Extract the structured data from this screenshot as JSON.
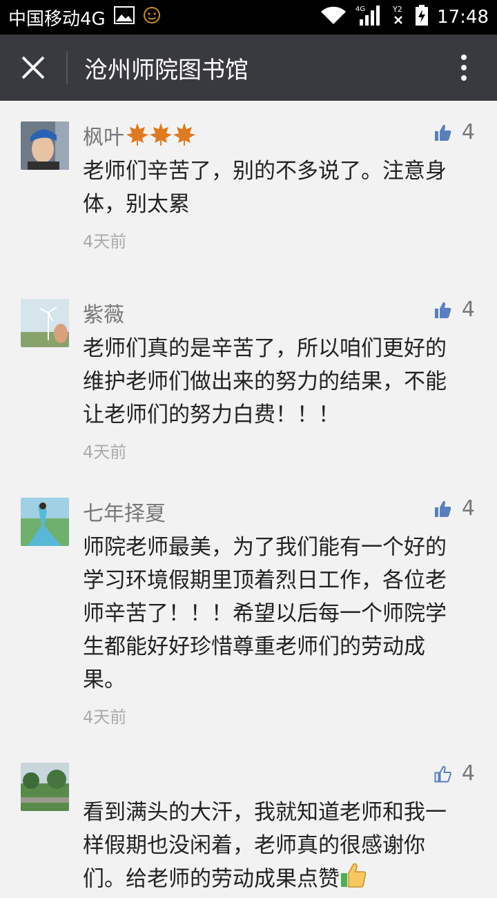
{
  "status_bar": {
    "carrier": "中国移动4G",
    "time": "17:48",
    "network_label": "4G",
    "sim_label": "2"
  },
  "title_bar": {
    "title": "沧州师院图书馆"
  },
  "comments": [
    {
      "name": "枫叶",
      "likes": "4",
      "text": "老师们辛苦了，别的不多说了。注意身体，别太累",
      "time": "4天前",
      "like_icon": "thumb-up-filled"
    },
    {
      "name": "紫薇",
      "likes": "4",
      "text": "老师们真的是辛苦了，所以咱们更好的维护老师们做出来的努力的结果，不能让老师们的努力白费！！！",
      "time": "4天前",
      "like_icon": "thumb-up-filled"
    },
    {
      "name": "七年择夏",
      "likes": "4",
      "text": "师院老师最美，为了我们能有一个好的学习环境假期里顶着烈日工作，各位老师辛苦了！！！希望以后每一个师院学生都能好好珍惜尊重老师们的劳动成果。",
      "time": "4天前",
      "like_icon": "thumb-up-filled"
    },
    {
      "name": "",
      "likes": "4",
      "text": "看到满头的大汗，我就知道老师和我一样假期也没闲着，老师真的很感谢你们。给老师的劳动成果点赞",
      "time": "",
      "like_icon": "thumb-up-outline"
    }
  ],
  "colors": {
    "accent_like": "#5a7fbf",
    "titlebar_bg": "#393a3f"
  }
}
